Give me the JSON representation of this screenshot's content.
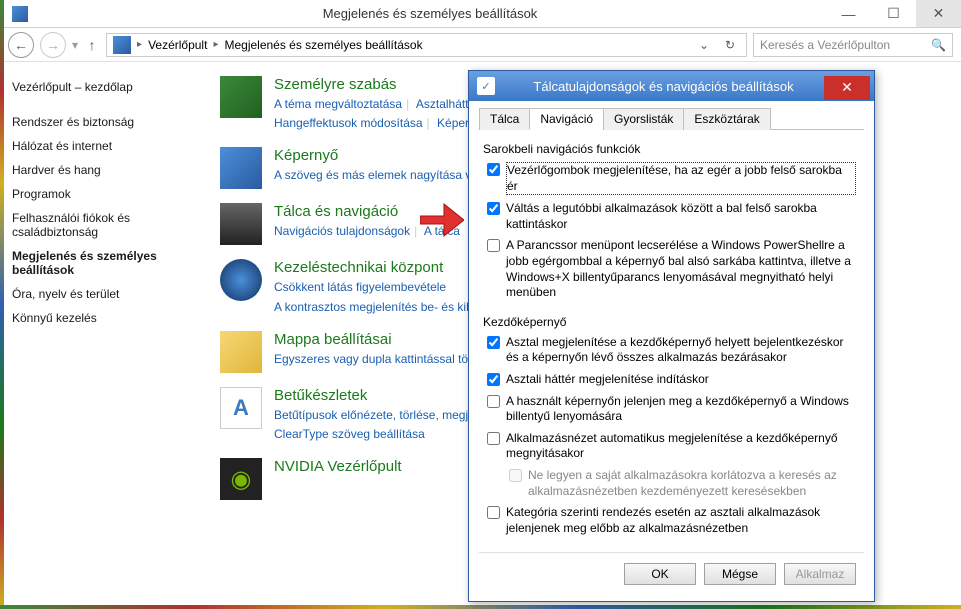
{
  "window": {
    "title": "Megjelenés és személyes beállítások"
  },
  "breadcrumb": {
    "root": "Vezérlőpult",
    "current": "Megjelenés és személyes beállítások"
  },
  "search": {
    "placeholder": "Keresés a Vezérlőpulton"
  },
  "sidebar": {
    "home": "Vezérlőpult – kezdőlap",
    "items": [
      "Rendszer és biztonság",
      "Hálózat és internet",
      "Hardver és hang",
      "Programok",
      "Felhasználói fiókok és családbiztonság"
    ],
    "current": "Megjelenés és személyes beállítások",
    "items2": [
      "Óra, nyelv és terület",
      "Könnyű kezelés"
    ]
  },
  "categories": {
    "personalize": {
      "title": "Személyre szabás",
      "links": [
        "A téma megváltoztatása",
        "Asztalháttér",
        "Hangeffektusok módosítása",
        "Képernyő"
      ]
    },
    "display": {
      "title": "Képernyő",
      "links": [
        "A szöveg és más elemek nagyítása va"
      ]
    },
    "taskbar": {
      "title": "Tálca és navigáció",
      "links": [
        "Navigációs tulajdonságok",
        "A tálca"
      ]
    },
    "ease": {
      "title": "Kezeléstechnikai központ",
      "links": [
        "Csökkent látás figyelembevétele",
        "A kontrasztos megjelenítés be- és kik"
      ]
    },
    "folder": {
      "title": "Mappa beállításai",
      "links": [
        "Egyszeres vagy dupla kattintással történő"
      ]
    },
    "fonts": {
      "title": "Betűkészletek",
      "links": [
        "Betűtípusok előnézete, törlése, megjelenítése",
        "ClearType szöveg beállítása"
      ]
    },
    "nvidia": {
      "title": "NVIDIA Vezérlőpult"
    }
  },
  "dialog": {
    "title": "Tálcatulajdonságok és navigációs beállítások",
    "tabs": [
      "Tálca",
      "Navigáció",
      "Gyorslisták",
      "Eszköztárak"
    ],
    "group1_title": "Sarokbeli navigációs funkciók",
    "group1": [
      {
        "checked": true,
        "label": "Vezérlőgombok megjelenítése, ha az egér a jobb felső sarokba ér"
      },
      {
        "checked": true,
        "label": "Váltás a legutóbbi alkalmazások között a bal felső sarokba kattintáskor"
      },
      {
        "checked": false,
        "label": "A Parancssor menüpont lecserélése a Windows PowerShellre a jobb egérgombbal a képernyő bal alsó sarkába kattintva, illetve a Windows+X billentyűparancs lenyomásával megnyitható helyi menüben"
      }
    ],
    "group2_title": "Kezdőképernyő",
    "group2": [
      {
        "checked": true,
        "label": "Asztal megjelenítése a kezdőképernyő helyett bejelentkezéskor és a képernyőn lévő összes alkalmazás bezárásakor"
      },
      {
        "checked": true,
        "label": "Asztali háttér megjelenítése indításkor"
      },
      {
        "checked": false,
        "label": "A használt képernyőn jelenjen meg a kezdőképernyő a Windows billentyű lenyomására"
      },
      {
        "checked": false,
        "label": "Alkalmazásnézet automatikus megjelenítése a kezdőképernyő megnyitásakor"
      },
      {
        "checked": false,
        "disabled": true,
        "indent": true,
        "label": "Ne legyen a saját alkalmazásokra korlátozva a keresés az alkalmazásnézetben kezdeményezett keresésekben"
      },
      {
        "checked": false,
        "label": "Kategória szerinti rendezés esetén az asztali alkalmazások jelenjenek meg előbb az alkalmazásnézetben"
      }
    ],
    "buttons": {
      "ok": "OK",
      "cancel": "Mégse",
      "apply": "Alkalmaz"
    }
  }
}
